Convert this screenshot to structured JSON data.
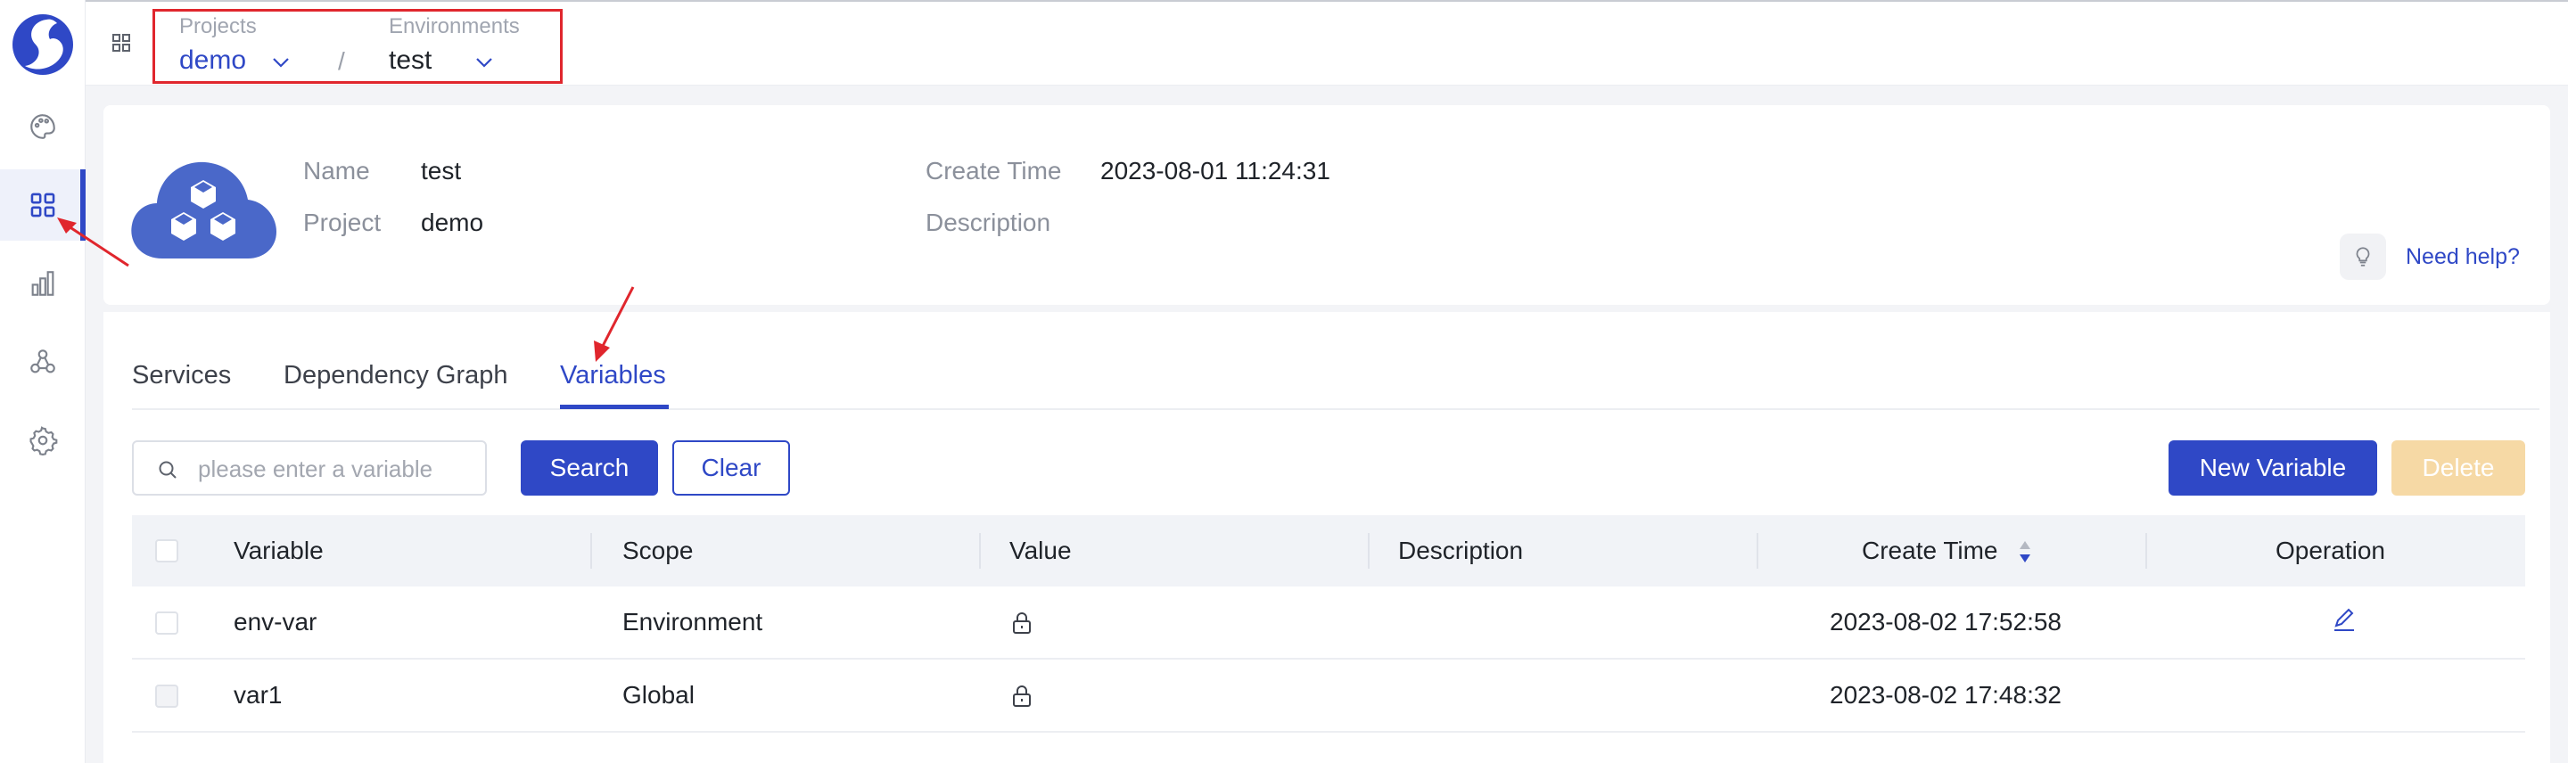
{
  "sidebar": {
    "items": [
      {
        "icon": "palette-icon"
      },
      {
        "icon": "grid-icon",
        "active": true
      },
      {
        "icon": "bar-chart-icon"
      },
      {
        "icon": "nodes-icon"
      },
      {
        "icon": "gear-icon"
      }
    ]
  },
  "topbar": {
    "projects_label": "Projects",
    "project_value": "demo",
    "separator": "/",
    "environments_label": "Environments",
    "environment_value": "test"
  },
  "env_info": {
    "name_label": "Name",
    "name_value": "test",
    "project_label": "Project",
    "project_value": "demo",
    "create_time_label": "Create Time",
    "create_time_value": "2023-08-01 11:24:31",
    "description_label": "Description",
    "description_value": "",
    "help_text": "Need help?"
  },
  "tabs": [
    {
      "label": "Services"
    },
    {
      "label": "Dependency Graph"
    },
    {
      "label": "Variables",
      "active": true
    }
  ],
  "toolbar": {
    "search_placeholder": "please enter a variable",
    "search_label": "Search",
    "clear_label": "Clear",
    "new_variable_label": "New Variable",
    "delete_label": "Delete"
  },
  "table": {
    "columns": [
      "Variable",
      "Scope",
      "Value",
      "Description",
      "Create Time",
      "Operation"
    ],
    "rows": [
      {
        "variable": "env-var",
        "scope": "Environment",
        "value": "locked",
        "description": "",
        "create_time": "2023-08-02 17:52:58",
        "editable": true
      },
      {
        "variable": "var1",
        "scope": "Global",
        "value": "locked",
        "description": "",
        "create_time": "2023-08-02 17:48:32",
        "editable": false
      }
    ]
  },
  "colors": {
    "accent": "#2f48c6",
    "annotation": "#e0262d",
    "delete_disabled": "#f6d9a5"
  }
}
